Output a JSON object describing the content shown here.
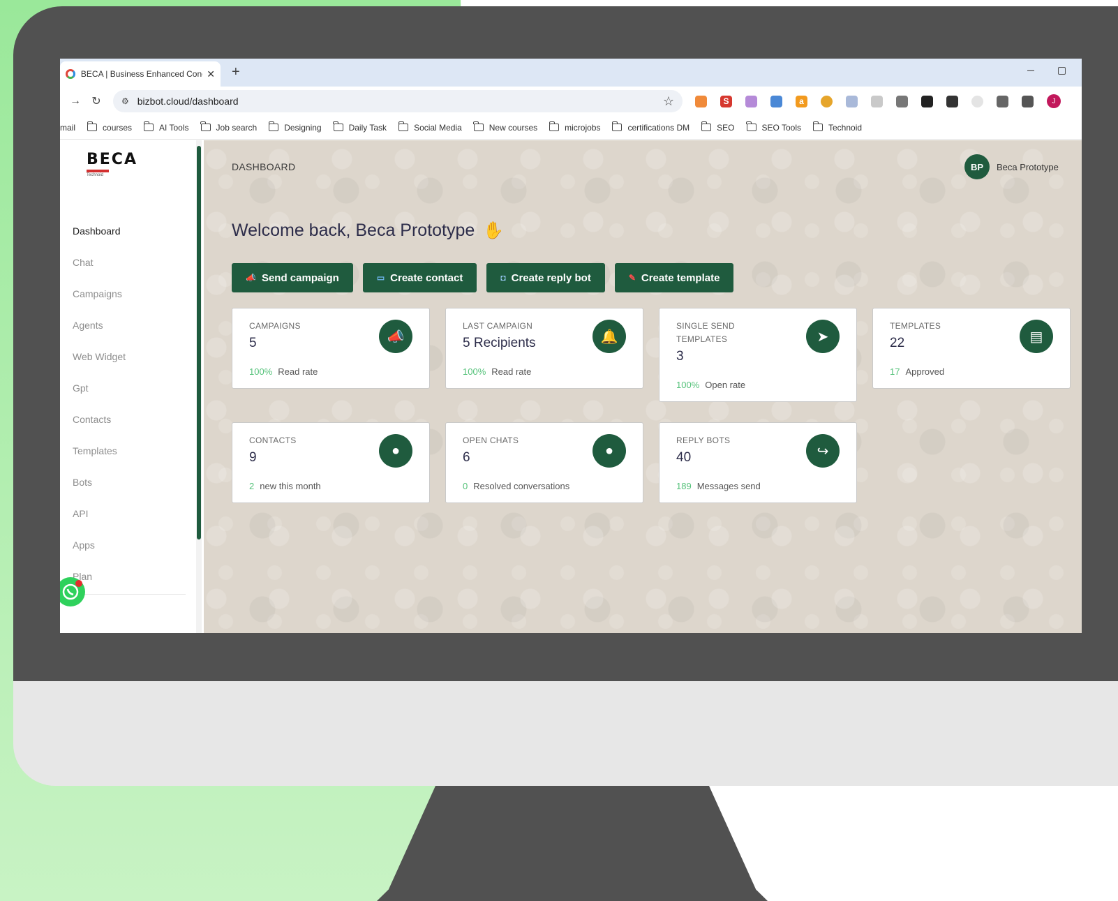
{
  "browser": {
    "tab_title": "BECA | Business Enhanced Conc",
    "tab_close": "✕",
    "new_tab": "+",
    "minimize": "–",
    "url": "bizbot.cloud/dashboard",
    "profile_initial": "J",
    "bookmarks": [
      {
        "label": "mail",
        "folder": false
      },
      {
        "label": "courses",
        "folder": true
      },
      {
        "label": "AI Tools",
        "folder": true
      },
      {
        "label": "Job search",
        "folder": true
      },
      {
        "label": "Designing",
        "folder": true
      },
      {
        "label": "Daily Task",
        "folder": true
      },
      {
        "label": "Social Media",
        "folder": true
      },
      {
        "label": "New courses",
        "folder": true
      },
      {
        "label": "microjobs",
        "folder": true
      },
      {
        "label": "certifications DM",
        "folder": true
      },
      {
        "label": "SEO",
        "folder": true
      },
      {
        "label": "SEO Tools",
        "folder": true
      },
      {
        "label": "Technoid",
        "folder": true
      }
    ]
  },
  "sidebar": {
    "logo_text": "BECA",
    "logo_sub": "Technoid",
    "items": [
      {
        "label": "Dashboard",
        "active": true
      },
      {
        "label": "Chat",
        "active": false
      },
      {
        "label": "Campaigns",
        "active": false
      },
      {
        "label": "Agents",
        "active": false
      },
      {
        "label": "Web Widget",
        "active": false
      },
      {
        "label": "Gpt",
        "active": false
      },
      {
        "label": "Contacts",
        "active": false
      },
      {
        "label": "Templates",
        "active": false
      },
      {
        "label": "Bots",
        "active": false
      },
      {
        "label": "API",
        "active": false
      },
      {
        "label": "Apps",
        "active": false
      },
      {
        "label": "Plan",
        "active": false
      }
    ]
  },
  "header": {
    "page_title": "DASHBOARD",
    "avatar_initials": "BP",
    "user_name": "Beca Prototype"
  },
  "main": {
    "welcome": "Welcome back, Beca Prototype",
    "actions": [
      {
        "label": "Send campaign",
        "icon": "megaphone-icon"
      },
      {
        "label": "Create contact",
        "icon": "id-card-icon"
      },
      {
        "label": "Create reply bot",
        "icon": "robot-icon"
      },
      {
        "label": "Create template",
        "icon": "pushpin-icon"
      }
    ],
    "cards": [
      {
        "label": "CAMPAIGNS",
        "value": "5",
        "highlight": "100%",
        "foot": "Read rate",
        "icon": "megaphone-icon"
      },
      {
        "label": "LAST CAMPAIGN",
        "value": "5 Recipients",
        "highlight": "100%",
        "foot": "Read rate",
        "icon": "bell-icon"
      },
      {
        "label": "SINGLE SEND TEMPLATES",
        "value": "3",
        "highlight": "100%",
        "foot": "Open rate",
        "icon": "paper-plane-icon"
      },
      {
        "label": "TEMPLATES",
        "value": "22",
        "highlight": "17",
        "foot": "Approved",
        "icon": "document-icon"
      },
      {
        "label": "CONTACTS",
        "value": "9",
        "highlight": "2",
        "foot": "new this month",
        "icon": "user-icon"
      },
      {
        "label": "OPEN CHATS",
        "value": "6",
        "highlight": "0",
        "foot": "Resolved conversations",
        "icon": "chat-bubble-icon"
      },
      {
        "label": "REPLY BOTS",
        "value": "40",
        "highlight": "189",
        "foot": "Messages send",
        "icon": "share-arrow-icon"
      }
    ]
  },
  "colors": {
    "brand": "#1f5b3e",
    "highlight": "#55c27a",
    "page_bg": "#ddd6cc"
  }
}
